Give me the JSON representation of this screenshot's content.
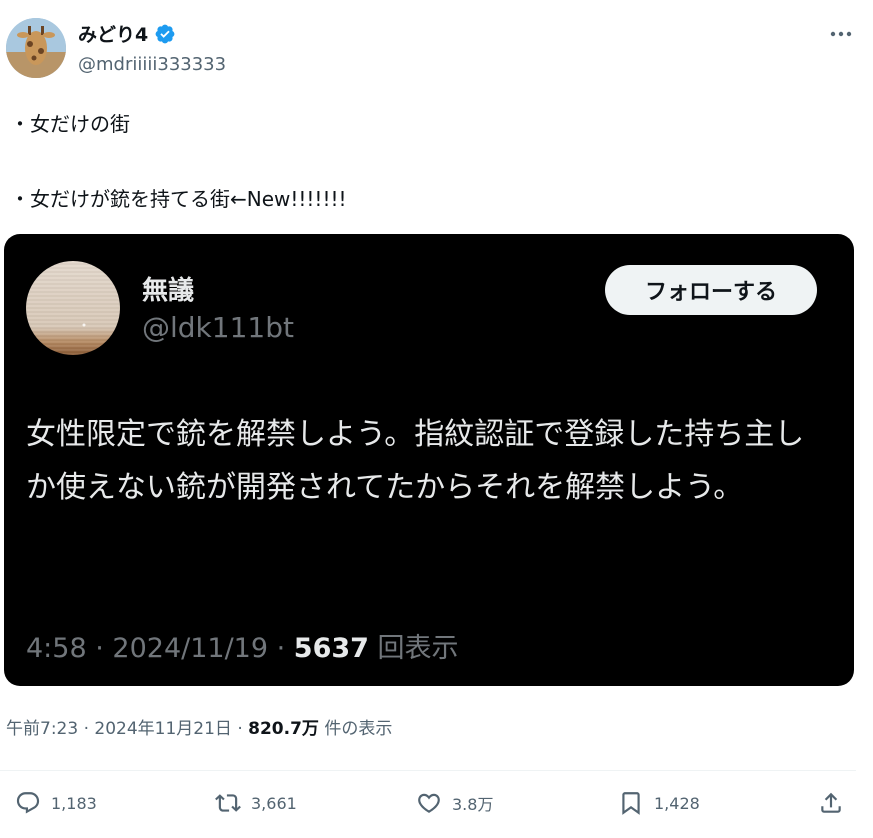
{
  "author": {
    "display_name": "みどり4",
    "handle": "@mdriiiii333333",
    "verified": true,
    "avatar": "giraffe-avatar"
  },
  "post": {
    "lines": [
      "・女だけの街",
      "・女だけが銃を持てる街←New!!!!!!!"
    ]
  },
  "quoted": {
    "display_name": "無議",
    "handle": "@ldk111bt",
    "follow_label": "フォローする",
    "body": "女性限定で銃を解禁しよう。指紋認証で登録した持ち主しか使えない銃が開発されてたからそれを解禁しよう。",
    "time": "4:58",
    "date": "2024/11/19",
    "views": "5637",
    "views_suffix": "回表示"
  },
  "meta": {
    "timestamp": "午前7:23 · 2024年11月21日 · ",
    "views": "820.7万",
    "views_suffix": " 件の表示"
  },
  "actions": {
    "replies": "1,183",
    "retweets": "3,661",
    "likes": "3.8万",
    "bookmarks": "1,428"
  },
  "colors": {
    "verified": "#1d9bf0",
    "text": "#0f1419",
    "secondary": "#536471",
    "media_bg": "#000000"
  }
}
